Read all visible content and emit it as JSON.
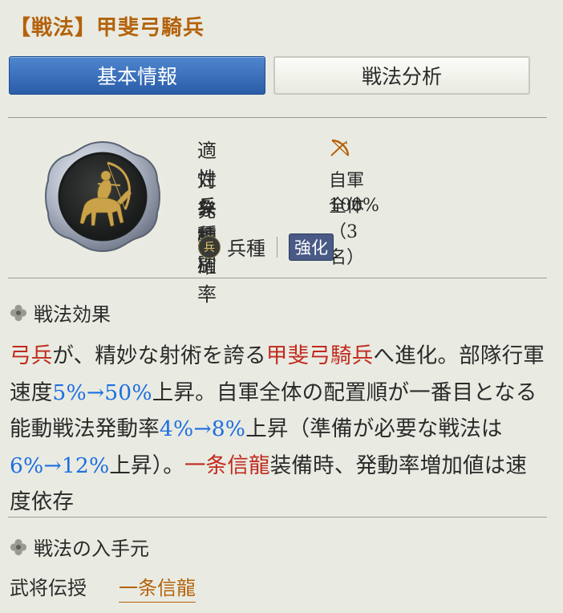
{
  "header": {
    "title": "【戦法】甲斐弓騎兵"
  },
  "tabs": [
    {
      "label": "基本情報",
      "active": true
    },
    {
      "label": "戦法分析",
      "active": false
    }
  ],
  "info": {
    "rows": [
      {
        "label": "適性兵種",
        "value": ""
      },
      {
        "label": "対象種別",
        "value": "自軍全体（3名）"
      },
      {
        "label": "発動確率",
        "value": "100%"
      }
    ],
    "troop_badge": "兵",
    "troop_label": "兵種",
    "enhance_badge": "強化"
  },
  "effect": {
    "heading": "戦法効果",
    "segments": [
      {
        "text": "弓兵",
        "color": "red"
      },
      {
        "text": "が、精妙な射術を誇る"
      },
      {
        "text": "甲斐弓騎兵",
        "color": "red"
      },
      {
        "text": "へ進化。部隊行軍速度"
      },
      {
        "text": "5%→50%",
        "color": "blue"
      },
      {
        "text": "上昇。自軍全体の配置順が一番目となる能動戦法発動率"
      },
      {
        "text": "4%→8%",
        "color": "blue"
      },
      {
        "text": "上昇（準備が必要な戦法は"
      },
      {
        "text": "6%→12%",
        "color": "blue"
      },
      {
        "text": "上昇）。"
      },
      {
        "text": "一条信龍",
        "color": "red"
      },
      {
        "text": "装備時、発動率増加値は速度依存"
      }
    ]
  },
  "source": {
    "heading": "戦法の入手元",
    "label": "武将伝授",
    "link": "一条信龍"
  },
  "colors": {
    "title": "#b4620c",
    "highlight_red": "#c12a1e",
    "highlight_blue": "#1e6fe0",
    "tab_active": "#2a5da8"
  }
}
